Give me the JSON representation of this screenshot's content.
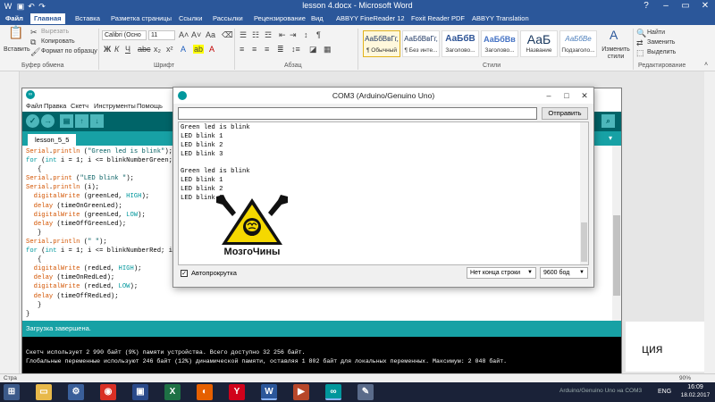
{
  "word": {
    "title": "lesson 4.docx - Microsoft Word",
    "tabs": [
      "Файл",
      "Главная",
      "Вставка",
      "Разметка страницы",
      "Ссылки",
      "Рассылки",
      "Рецензирование",
      "Вид",
      "ABBYY FineReader 12",
      "Foxit Reader PDF",
      "ABBYY Translation"
    ],
    "clipboard": {
      "paste": "Вставить",
      "cut": "Вырезать",
      "copy": "Копировать",
      "format_painter": "Формат по образцу",
      "group": "Буфер обмена"
    },
    "font": {
      "name": "Calibri (Осно",
      "size": "11",
      "group": "Шрифт"
    },
    "paragraph_group": "Абзац",
    "styles": {
      "items": [
        {
          "sample": "АаБбВвГг,",
          "name": "¶ Обычный"
        },
        {
          "sample": "АаБбВвГг,",
          "name": "¶ Без инте..."
        },
        {
          "sample": "АаБбВ",
          "name": "Заголово..."
        },
        {
          "sample": "АаБбВв",
          "name": "Заголово..."
        },
        {
          "sample": "АаБ",
          "name": "Название"
        },
        {
          "sample": "АаБбВе",
          "name": "Подзаголо..."
        }
      ],
      "change": "Изменить стили",
      "group": "Стили"
    },
    "editing": {
      "find": "Найти",
      "replace": "Заменить",
      "select": "Выделить",
      "group": "Редактирование"
    },
    "doc_fragment": "ция",
    "status_left": "Стра",
    "status_zoom": "90%"
  },
  "ide": {
    "menu": [
      "Файл",
      "Правка",
      "Скетч",
      "Инструменты",
      "Помощь"
    ],
    "tab_name": "lesson_5_5",
    "status": "Загрузка завершена.",
    "console": [
      "Скетч использует 2 990 байт (9%) памяти устройства. Всего доступно 32 256 байт.",
      "Глобальные переменные используют 246 байт (12%) динамической памяти, оставляя 1 802 байт для локальных переменных. Максимум: 2 048 байт."
    ],
    "code": [
      "Serial.println (\"Green led is blink\");",
      "for (int i = 1; i <= blinkNumberGreen; i",
      "   {",
      "Serial.print (\"LED blink \");",
      "Serial.println (i);",
      "  digitalWrite (greenLed, HIGH);",
      "  delay (timeOnGreenLed);",
      "  digitalWrite (greenLed, LOW);",
      "  delay (timeOffGreenLed);",
      "   }",
      "Serial.println (\" \");",
      "for (int i = 1; i <= blinkNumberRed; i++",
      "   {",
      "  digitalWrite (redLed, HIGH);",
      "  delay (timeOnRedLed);",
      "  digitalWrite (redLed, LOW);",
      "  delay (timeOffRedLed);",
      "   }",
      "}"
    ]
  },
  "serial": {
    "title": "COM3 (Arduino/Genuino Uno)",
    "send_label": "Отправить",
    "input_value": "",
    "output": [
      "Green led is blink",
      "LED blink 1",
      "LED blink 2",
      "LED blink 3",
      "",
      "Green led is blink",
      "LED blink 1",
      "LED blink 2",
      "LED blink 3"
    ],
    "autoscroll_label": "Автопрокрутка",
    "autoscroll_checked": true,
    "line_ending": "Нет конца строки",
    "baud": "9600 бод"
  },
  "brand": {
    "text": "МозгоЧины"
  },
  "taskbar": {
    "tray_app": "Arduino/Genuino Uno на COM3",
    "lang": "ENG",
    "time": "16:09",
    "date": "18.02.2017"
  },
  "colors": {
    "word_blue": "#2b579a",
    "arduino_teal": "#00979c",
    "arduino_dark": "#006468",
    "logo_yellow": "#f5d800"
  }
}
